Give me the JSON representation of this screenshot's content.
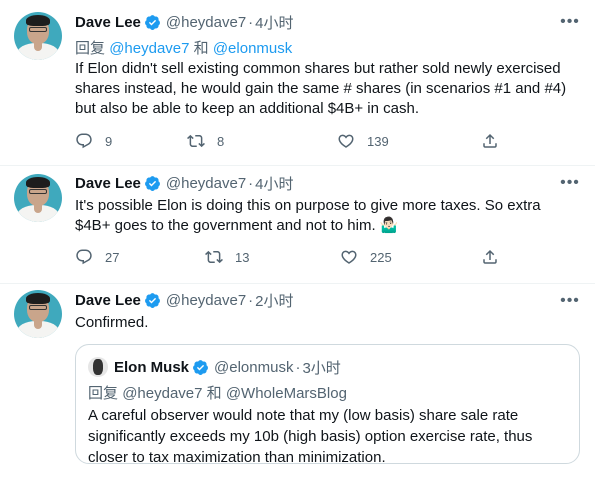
{
  "tweets": [
    {
      "name": "Dave Lee",
      "handle": "@heydave7",
      "dot": "·",
      "time": "4小时",
      "reply_prefix": "回复",
      "reply_mention_1": "@heydave7",
      "reply_and": "和",
      "reply_mention_2": "@elonmusk",
      "text": "If Elon didn't sell existing common shares but rather sold newly exercised shares instead, he would gain the same # shares (in scenarios #1 and #4) but also be able to keep an additional $4B+ in cash.",
      "replies": "9",
      "retweets": "8",
      "likes": "139"
    },
    {
      "name": "Dave Lee",
      "handle": "@heydave7",
      "dot": "·",
      "time": "4小时",
      "text": "It's possible Elon is doing this on purpose to give more taxes.  So extra $4B+ goes to the government and not to him. 🤷🏻‍♂️",
      "replies": "27",
      "retweets": "13",
      "likes": "225"
    },
    {
      "name": "Dave Lee",
      "handle": "@heydave7",
      "dot": "·",
      "time": "2小时",
      "text": "Confirmed.",
      "quote": {
        "name": "Elon Musk",
        "handle": "@elonmusk",
        "dot": "·",
        "time": "3小时",
        "reply_prefix": "回复",
        "reply_mention_1": "@heydave7",
        "reply_and": "和",
        "reply_mention_2": "@WholeMarsBlog",
        "text": "A careful observer would note that my (low basis) share sale rate significantly exceeds my 10b (high basis) option exercise rate, thus closer to tax maximization than minimization."
      }
    }
  ],
  "icons": {
    "more": "more-horizontal-icon",
    "reply": "reply-icon",
    "retweet": "retweet-icon",
    "like": "like-icon",
    "share": "share-icon",
    "verified": "verified-badge-icon"
  },
  "colors": {
    "accent": "#1d9bf0",
    "secondary_text": "#536471",
    "border": "#eff3f4"
  }
}
